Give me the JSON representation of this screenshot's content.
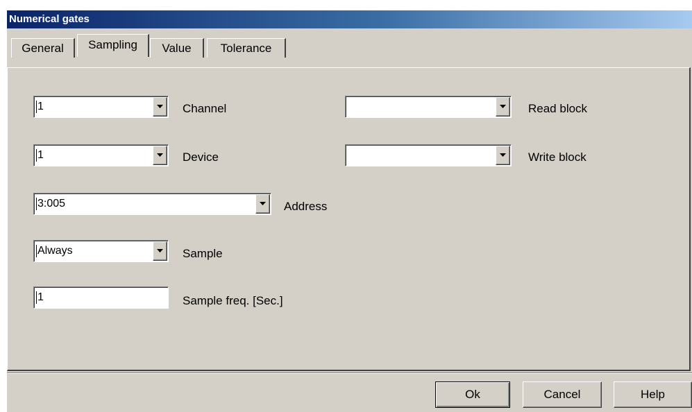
{
  "window": {
    "title": "Numerical gates"
  },
  "tabs": [
    {
      "label": "General"
    },
    {
      "label": "Sampling"
    },
    {
      "label": "Value"
    },
    {
      "label": "Tolerance"
    }
  ],
  "fields": {
    "channel": {
      "value": "1",
      "label": "Channel"
    },
    "device": {
      "value": "1",
      "label": "Device"
    },
    "address": {
      "value": "3:005",
      "label": "Address"
    },
    "sample": {
      "value": "Always",
      "label": "Sample"
    },
    "sample_freq": {
      "value": "1",
      "label": "Sample freq. [Sec.]"
    },
    "read_block": {
      "value": "",
      "label": "Read block"
    },
    "write_block": {
      "value": "",
      "label": "Write block"
    }
  },
  "buttons": {
    "ok": "Ok",
    "cancel": "Cancel",
    "help": "Help"
  },
  "icons": {
    "dropdown": "chevron-down-icon"
  },
  "colors": {
    "face": "#d4d0c8",
    "title_start": "#0a246a",
    "title_end": "#a6caf0"
  }
}
